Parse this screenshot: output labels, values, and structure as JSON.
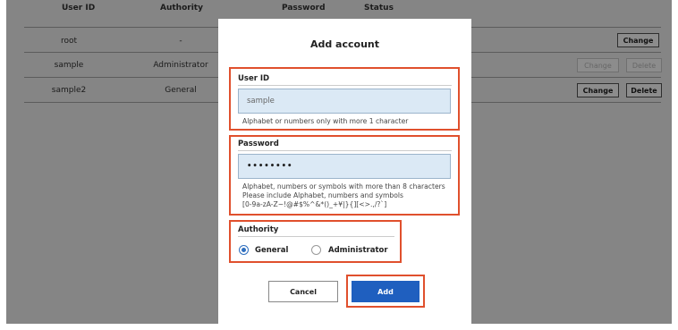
{
  "table": {
    "headers": [
      "User ID",
      "Authority",
      "Password",
      "Status"
    ],
    "rows": [
      {
        "user_id": "root",
        "authority": "-",
        "change_label": "Change",
        "delete_label": ""
      },
      {
        "user_id": "sample",
        "authority": "Administrator",
        "change_label": "Change",
        "delete_label": "Delete"
      },
      {
        "user_id": "sample2",
        "authority": "General",
        "change_label": "Change",
        "delete_label": "Delete"
      }
    ]
  },
  "modal": {
    "title": "Add account",
    "user_id": {
      "label": "User ID",
      "value": "sample",
      "hint": "Alphabet or numbers only with more 1 character"
    },
    "password": {
      "label": "Password",
      "value": "••••••••",
      "hint_line1": "Alphabet, numbers or symbols with more than 8 characters",
      "hint_line2": "Please include Alphabet, numbers and symbols",
      "hint_line3": "[0-9a-zA-Z~!@#$%^&*()_+¥|}{][<>.,/?`]"
    },
    "authority": {
      "label": "Authority",
      "options": [
        "General",
        "Administrator"
      ],
      "selected": "General"
    },
    "cancel_label": "Cancel",
    "add_label": "Add"
  },
  "colors": {
    "highlight": "#e0502d",
    "primary": "#1f5fbf",
    "field_bg": "#dbe9f5"
  }
}
